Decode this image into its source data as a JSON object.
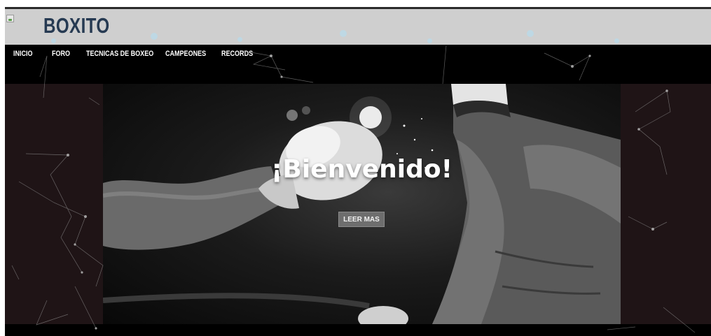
{
  "header": {
    "brand": "BOXITO",
    "logo_icon": "broken-image-icon",
    "background_color": "#cfcfcf",
    "brand_color": "#263a52"
  },
  "nav": {
    "items": [
      {
        "label": "INICIO"
      },
      {
        "label": "FORO"
      },
      {
        "label": "TECNICAS DE BOXEO"
      },
      {
        "label": "CAMPEONES"
      },
      {
        "label": "RECORDS"
      }
    ]
  },
  "hero": {
    "title": "¡Bienvenido!",
    "button_label": "LEER MAS",
    "image": "boxing-punch-photo"
  },
  "colors": {
    "page_bg": "#000000",
    "side_panels": "#1f1416",
    "button_bg": "#6e6e6e"
  }
}
